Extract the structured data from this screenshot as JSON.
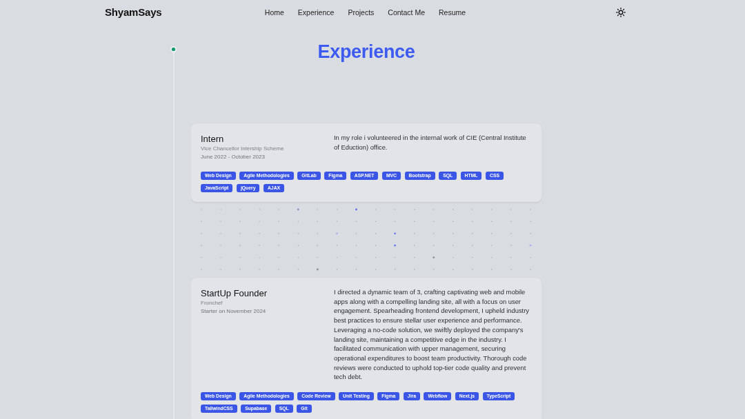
{
  "header": {
    "logo": "ShyamSays",
    "nav": [
      "Home",
      "Experience",
      "Projects",
      "Contact Me",
      "Resume"
    ]
  },
  "page_title": "Experience",
  "experiences": [
    {
      "role": "Intern",
      "organization": "Vice Chancellor Intership Scheme",
      "period": "June 2022 - October 2023",
      "description": "In my role i volunteered in the internal work of CIE (Central Institute of Eduction) office.",
      "skills": [
        "Web Design",
        "Agile Methodologies",
        "GitLab",
        "Figma",
        "ASP.NET",
        "MVC",
        "Bootstrap",
        "SQL",
        "HTML",
        "CSS",
        "JavaScript",
        "jQuery",
        "AJAX"
      ]
    },
    {
      "role": "StartUp Founder",
      "organization": "Fronchef",
      "period": "Starter on November 2024",
      "description": "I directed a dynamic team of 3, crafting captivating web and mobile apps along with a compelling landing site, all with a focus on user engagement. Spearheading frontend development, I upheld industry best practices to ensure stellar user experience and performance. Leveraging a no-code solution, we swiftly deployed the company's landing site, maintaining a competitive edge in the industry. I facilitated communication with upper management, securing operational expenditures to boost team productivity. Thorough code reviews were conducted to uphold top-tier code quality and prevent tech debt.",
      "skills": [
        "Web Design",
        "Agile Methodologies",
        "Code Review",
        "Unit Testing",
        "Figma",
        "Jira",
        "Webflow",
        "Next.js",
        "TypeScript",
        "TailwindCSS",
        "Supabase",
        "SQL",
        "Git"
      ]
    }
  ]
}
